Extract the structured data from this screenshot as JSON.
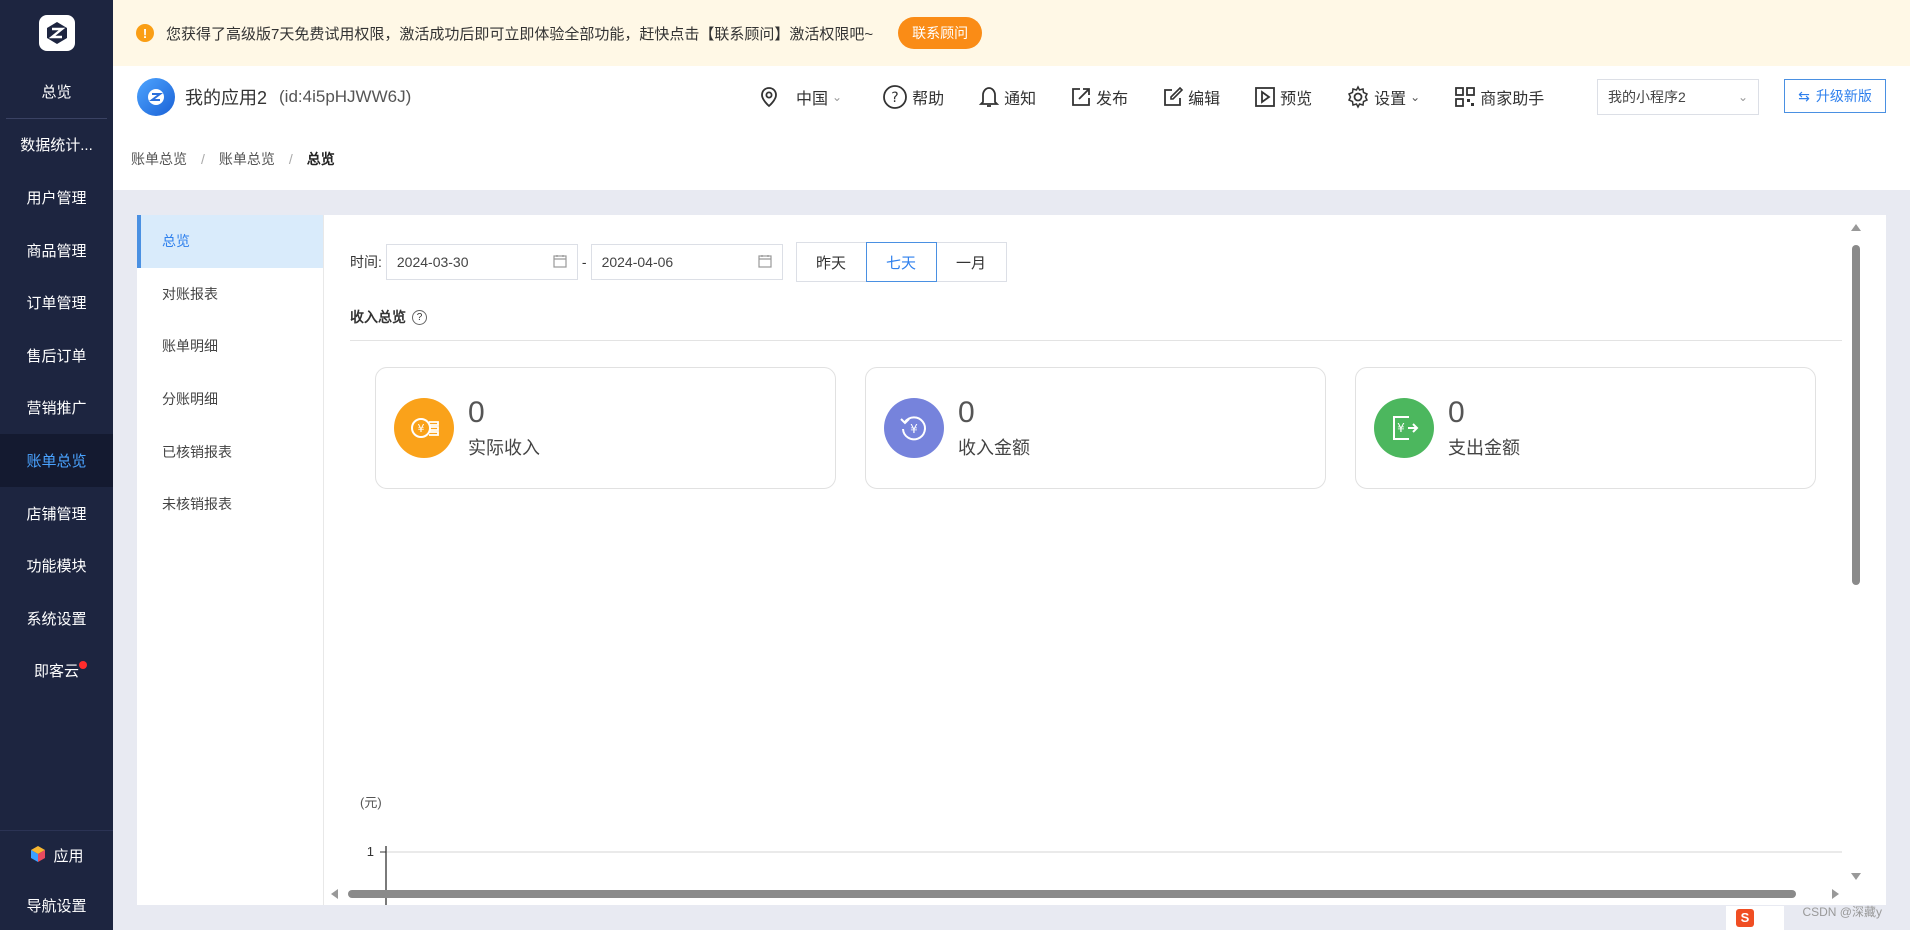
{
  "sidebar": {
    "items": [
      {
        "label": "总览"
      },
      {
        "label": "数据统计..."
      },
      {
        "label": "用户管理"
      },
      {
        "label": "商品管理"
      },
      {
        "label": "订单管理"
      },
      {
        "label": "售后订单"
      },
      {
        "label": "营销推广"
      },
      {
        "label": "账单总览"
      },
      {
        "label": "店铺管理"
      },
      {
        "label": "功能模块"
      },
      {
        "label": "系统设置"
      },
      {
        "label": "即客云"
      }
    ],
    "app_label": "应用",
    "nav_settings_label": "导航设置"
  },
  "notice": {
    "text": "您获得了高级版7天免费试用权限，激活成功后即可立即体验全部功能，赶快点击【联系顾问】激活权限吧~",
    "button": "联系顾问"
  },
  "header": {
    "app_name": "我的应用2",
    "app_id": "(id:4i5pHJWW6J)",
    "location": "中国",
    "help": "帮助",
    "notify": "通知",
    "publish": "发布",
    "edit": "编辑",
    "preview": "预览",
    "settings": "设置",
    "merchant_assistant": "商家助手",
    "mini_program_select": "我的小程序2",
    "upgrade": "升级新版"
  },
  "breadcrumb": {
    "items": [
      "账单总览",
      "账单总览"
    ],
    "current": "总览"
  },
  "subnav": {
    "items": [
      {
        "label": "总览"
      },
      {
        "label": "对账报表"
      },
      {
        "label": "账单明细"
      },
      {
        "label": "分账明细"
      },
      {
        "label": "已核销报表"
      },
      {
        "label": "未核销报表"
      }
    ]
  },
  "filter": {
    "label": "时间:",
    "start_date": "2024-03-30",
    "end_date": "2024-04-06",
    "dash": "-",
    "ranges": [
      "昨天",
      "七天",
      "一月"
    ],
    "active_range": "七天"
  },
  "section": {
    "title": "收入总览"
  },
  "cards": [
    {
      "value": "0",
      "label": "实际收入",
      "color": "#faa21a",
      "icon": "coins-icon"
    },
    {
      "value": "0",
      "label": "收入金额",
      "color": "#7683dc",
      "icon": "refund-yen-icon"
    },
    {
      "value": "0",
      "label": "支出金额",
      "color": "#4cb75e",
      "icon": "expense-yen-icon"
    }
  ],
  "chart_data": {
    "type": "line",
    "ylabel": "(元)",
    "y_ticks": [
      "1"
    ],
    "ylim": [
      0,
      1
    ],
    "series": []
  },
  "watermark": "CSDN @深藏y",
  "colors": {
    "sidebar_bg": "#1d2540",
    "accent": "#2f80ed",
    "notice_bg": "#fff8e6",
    "notice_button": "#fa8c16"
  }
}
